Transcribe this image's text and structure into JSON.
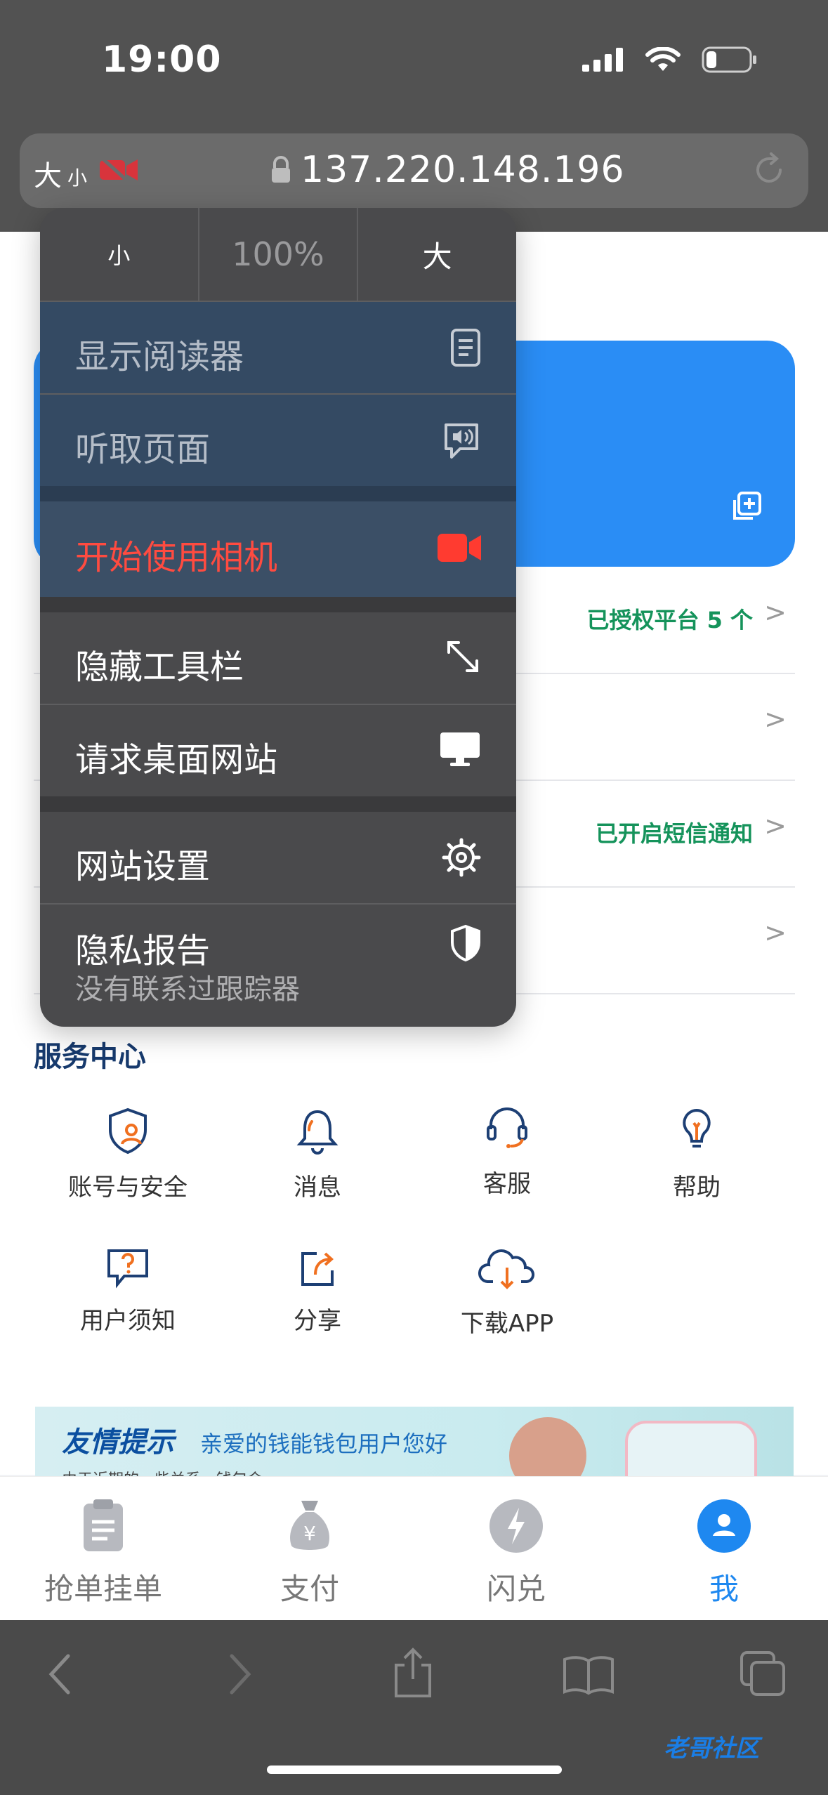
{
  "status_bar": {
    "time": "19:00"
  },
  "address_bar": {
    "text_size_big": "大",
    "text_size_small": "小",
    "url": "137.220.148.196"
  },
  "menu": {
    "zoom": {
      "smaller": "小",
      "level": "100%",
      "larger": "大"
    },
    "items": [
      {
        "label": "显示阅读器",
        "icon": "reader-icon"
      },
      {
        "label": "听取页面",
        "icon": "speaker-icon"
      },
      {
        "label": "开始使用相机",
        "icon": "camera-icon",
        "color": "#ff3b30"
      },
      {
        "label": "隐藏工具栏",
        "icon": "expand-arrows-icon"
      },
      {
        "label": "请求桌面网站",
        "icon": "desktop-icon"
      },
      {
        "label": "网站设置",
        "icon": "gear-icon"
      },
      {
        "label": "隐私报告",
        "subtitle": "没有联系过跟踪器",
        "icon": "shield-icon"
      }
    ]
  },
  "list_rows": [
    {
      "value": "已授权平台 5 个",
      "arrow": ">"
    },
    {
      "value": "",
      "arrow": ">"
    },
    {
      "value": "已开启短信通知",
      "arrow": ">"
    },
    {
      "value": "",
      "arrow": ">"
    }
  ],
  "service_center": {
    "title": "服务中心",
    "items": [
      {
        "label": "账号与安全",
        "icon": "account-security-icon"
      },
      {
        "label": "消息",
        "icon": "bell-icon"
      },
      {
        "label": "客服",
        "icon": "headset-icon"
      },
      {
        "label": "帮助",
        "icon": "lightbulb-icon"
      },
      {
        "label": "用户须知",
        "icon": "question-bubble-icon"
      },
      {
        "label": "分享",
        "icon": "share-icon"
      },
      {
        "label": "下载APP",
        "icon": "cloud-download-icon"
      }
    ]
  },
  "banner": {
    "title": "友情提示",
    "subtitle": "亲爱的钱能钱包用户您好",
    "text": "由于近期的一些关系，钱包会"
  },
  "tabbar": {
    "items": [
      {
        "label": "抢单挂单",
        "icon": "clipboard-icon"
      },
      {
        "label": "支付",
        "icon": "money-bag-icon"
      },
      {
        "label": "闪兑",
        "icon": "lightning-icon"
      },
      {
        "label": "我",
        "icon": "user-icon",
        "active": true
      }
    ],
    "active_color": "#1e88f0"
  },
  "watermark": "老哥社区",
  "colors": {
    "accent_blue": "#2a8df5",
    "status_green": "#15935b",
    "camera_red": "#ff3b30"
  }
}
